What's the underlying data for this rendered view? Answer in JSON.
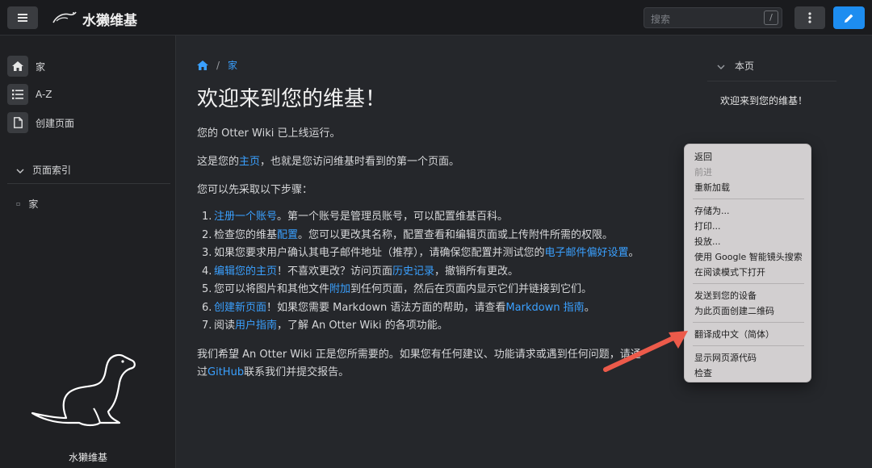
{
  "header": {
    "site_title": "水獭维基",
    "search_placeholder": "搜索",
    "search_shortcut": "/",
    "icons": [
      "menu-icon",
      "otter-logo",
      "kebab-icon",
      "pencil-icon"
    ],
    "accent_color": "#1d8df0"
  },
  "sidebar": {
    "items": [
      {
        "label": "家",
        "icon": "home-icon"
      },
      {
        "label": "A-Z",
        "icon": "list-icon"
      },
      {
        "label": "创建页面",
        "icon": "file-icon"
      }
    ],
    "section_label": "页面索引",
    "pages": [
      "家"
    ],
    "caption": "水獭维基"
  },
  "breadcrumb": {
    "current": "家"
  },
  "main": {
    "title": "欢迎来到您的维基！",
    "p1": "您的 Otter Wiki 已上线运行。",
    "p2_a": "这是您的",
    "p2_link": "主页",
    "p2_b": "，也就是您访问维基时看到的第一个页面。",
    "p3": "您可以先采取以下步骤：",
    "steps": [
      {
        "n": "1.",
        "link1": "注册一个账号",
        "text1": "。第一个账号是管理员账号，可以配置维基百科。"
      },
      {
        "n": "2.",
        "text0": "检查您的维基",
        "link1": "配置",
        "text1": "。您可以更改其名称，配置查看和编辑页面或上传附件所需的权限。"
      },
      {
        "n": "3.",
        "text0": "如果您要求用户确认其电子邮件地址（推荐），请确保您配置并测试您的",
        "link1": "电子邮件偏好设置",
        "text1": "。"
      },
      {
        "n": "4.",
        "link1": "编辑您的主页",
        "text1": "！不喜欢更改？访问页面",
        "link2": "历史记录",
        "text2": "，撤销所有更改。"
      },
      {
        "n": "5.",
        "text0": "您可以将图片和其他文件",
        "link1": "附加",
        "text1": "到任何页面，然后在页面内显示它们并链接到它们。"
      },
      {
        "n": "6.",
        "link1": "创建新页面",
        "text1": "！如果您需要 Markdown 语法方面的帮助，请查看",
        "link2": "Markdown 指南",
        "text2": "。"
      },
      {
        "n": "7.",
        "text0": "阅读",
        "link1": "用户指南",
        "text1": "，了解 An Otter Wiki 的各项功能。"
      }
    ],
    "p4_a": "我们希望 An Otter Wiki 正是您所需要的。如果您有任何建议、功能请求或遇到任何问题，请通",
    "p4_b": "过",
    "p4_link": "GitHub",
    "p4_c": "联系我们并提交报告。"
  },
  "toc": {
    "heading": "本页",
    "items": [
      "欢迎来到您的维基！"
    ]
  },
  "context_menu": {
    "items": [
      {
        "label": "返回",
        "disabled": false
      },
      {
        "label": "前进",
        "disabled": true
      },
      {
        "label": "重新加载",
        "disabled": false
      },
      {
        "label": "存储为...",
        "disabled": false
      },
      {
        "label": "打印...",
        "disabled": false
      },
      {
        "label": "投放...",
        "disabled": false
      },
      {
        "label": "使用 Google 智能镜头搜索",
        "disabled": false
      },
      {
        "label": "在阅读模式下打开",
        "disabled": false
      },
      {
        "label": "发送到您的设备",
        "disabled": false
      },
      {
        "label": "为此页面创建二维码",
        "disabled": false
      },
      {
        "label": "翻译成中文（简体）",
        "disabled": false
      },
      {
        "label": "显示网页源代码",
        "disabled": false
      },
      {
        "label": "检查",
        "disabled": false
      }
    ]
  }
}
